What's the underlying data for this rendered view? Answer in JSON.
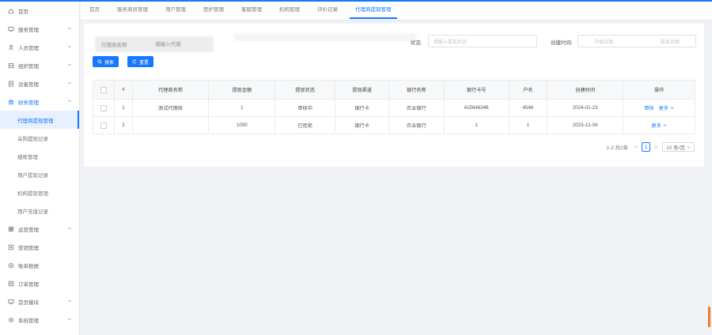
{
  "sidebar": {
    "items": [
      {
        "label": "首页",
        "icon": "home-icon",
        "arrow": false
      },
      {
        "label": "服务管理",
        "icon": "monitor-icon",
        "arrow": true
      },
      {
        "label": "人员管理",
        "icon": "user-icon",
        "arrow": true
      },
      {
        "label": "组织管理",
        "icon": "org-icon",
        "arrow": true
      },
      {
        "label": "设备管理",
        "icon": "doc-icon",
        "arrow": true
      },
      {
        "label": "财务管理",
        "icon": "finance-icon",
        "arrow": true,
        "state": "active-parent"
      },
      {
        "label": "代理商提现管理",
        "sub": true,
        "state": "active"
      },
      {
        "label": "采购提现记录",
        "sub": true
      },
      {
        "label": "楼栋管理",
        "sub": true
      },
      {
        "label": "用户提现记录",
        "sub": true
      },
      {
        "label": "机构提现管理",
        "sub": true
      },
      {
        "label": "用户充值记录",
        "sub": true
      },
      {
        "label": "运营管理",
        "icon": "grid-icon",
        "arrow": true
      },
      {
        "label": "营销管理",
        "icon": "tag-icon",
        "arrow": false
      },
      {
        "label": "账单数据",
        "icon": "circle-icon",
        "arrow": false
      },
      {
        "label": "订单管理",
        "icon": "list-icon",
        "arrow": false
      },
      {
        "label": "首页模块",
        "icon": "monitor-icon",
        "arrow": true
      },
      {
        "label": "系统管理",
        "icon": "gear-icon",
        "arrow": true
      }
    ]
  },
  "tabs": [
    {
      "label": "首页"
    },
    {
      "label": "服务商员管理"
    },
    {
      "label": "用户管理"
    },
    {
      "label": "医护管理"
    },
    {
      "label": "客服管理"
    },
    {
      "label": "机构管理"
    },
    {
      "label": "评价记录"
    },
    {
      "label": "代理商提现管理",
      "active": true
    }
  ],
  "filters": {
    "status_label": "状态:",
    "status_placeholder": "请输入提现状态",
    "time_label": "创建时间:",
    "start_placeholder": "开始日期",
    "sep": "~",
    "end_placeholder": "结束日期",
    "blurred_field_label": "代理商名称",
    "blurred_field_value": "请输入代理"
  },
  "buttons": {
    "search": "搜索",
    "reset": "重置"
  },
  "table": {
    "headers": [
      "#",
      "代理商名称",
      "提现金额",
      "提现状态",
      "提现渠道",
      "银行名称",
      "银行卡号",
      "户名",
      "创建时间",
      "操作"
    ],
    "rows": [
      {
        "index": "1",
        "name": "测试代理商",
        "amount": "1",
        "status": "审核中",
        "channel": "银行卡",
        "bank": "农业银行",
        "card": "415646346",
        "account": "4546",
        "created": "2024-01-23",
        "ops": [
          "审核",
          "更多"
        ]
      },
      {
        "index": "2",
        "name": "",
        "amount": "1000",
        "status": "已拒绝",
        "channel": "银行卡",
        "bank": "农业银行",
        "card": "1",
        "account": "1",
        "created": "2023-12-04",
        "ops": [
          "更多"
        ]
      }
    ]
  },
  "pagination": {
    "total": "1-2 共2条",
    "prev": "<",
    "page": "1",
    "next": ">",
    "size": "10 条/页"
  },
  "colors": {
    "accent": "#1677ff",
    "edge_mark": "#f07a2b"
  }
}
